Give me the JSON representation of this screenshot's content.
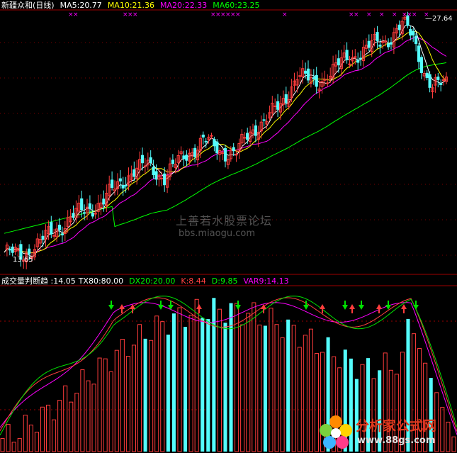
{
  "top_header": {
    "title": "新疆众和(日线)",
    "ma5": "MA5:20.77",
    "ma10": "MA10:21.36",
    "ma20": "MA20:22.33",
    "ma60": "MA60:23.25"
  },
  "bottom_header": {
    "title": "成交量判断趋 :14.05",
    "tx": "TX80:80.00",
    "dx": "DX20:20.00",
    "k": "K:8.44",
    "d": "D:9.85",
    "var": "VAR9:14.13"
  },
  "price_labels": {
    "high": "27.64",
    "low": "13.65"
  },
  "watermark": {
    "line1": "上善若水股票论坛",
    "line2": "bbs.miaogu.com"
  },
  "logo": {
    "name": "分析家公式网",
    "url": "www.88gs.com"
  },
  "colors": {
    "up": "#ff3c3c",
    "down": "#54fcfc",
    "ma5": "#ffffff",
    "ma10": "#ffff00",
    "ma20": "#ff00ff",
    "ma60": "#00ff00",
    "frame": "#a00000",
    "k": "#ff4040",
    "d": "#00e000",
    "var": "#ff00ff"
  },
  "chart_data": [
    {
      "type": "candlestick",
      "title": "新疆众和(日线)",
      "ylim": [
        13.65,
        27.64
      ],
      "series": [
        {
          "name": "MA5",
          "last": 20.77
        },
        {
          "name": "MA10",
          "last": 21.36
        },
        {
          "name": "MA20",
          "last": 22.33
        },
        {
          "name": "MA60",
          "last": 23.25
        }
      ],
      "annotations": [
        {
          "text": "27.64",
          "kind": "high"
        },
        {
          "text": "13.65",
          "kind": "low"
        }
      ]
    },
    {
      "type": "bar",
      "title": "成交量判断趋 :14.05",
      "ylim": [
        0,
        100
      ],
      "reference_lines": [
        80,
        20
      ],
      "series": [
        {
          "name": "TX80",
          "value": 80.0
        },
        {
          "name": "DX20",
          "value": 20.0
        },
        {
          "name": "K",
          "value": 8.44
        },
        {
          "name": "D",
          "value": 9.85
        },
        {
          "name": "VAR9",
          "value": 14.13
        }
      ]
    }
  ]
}
